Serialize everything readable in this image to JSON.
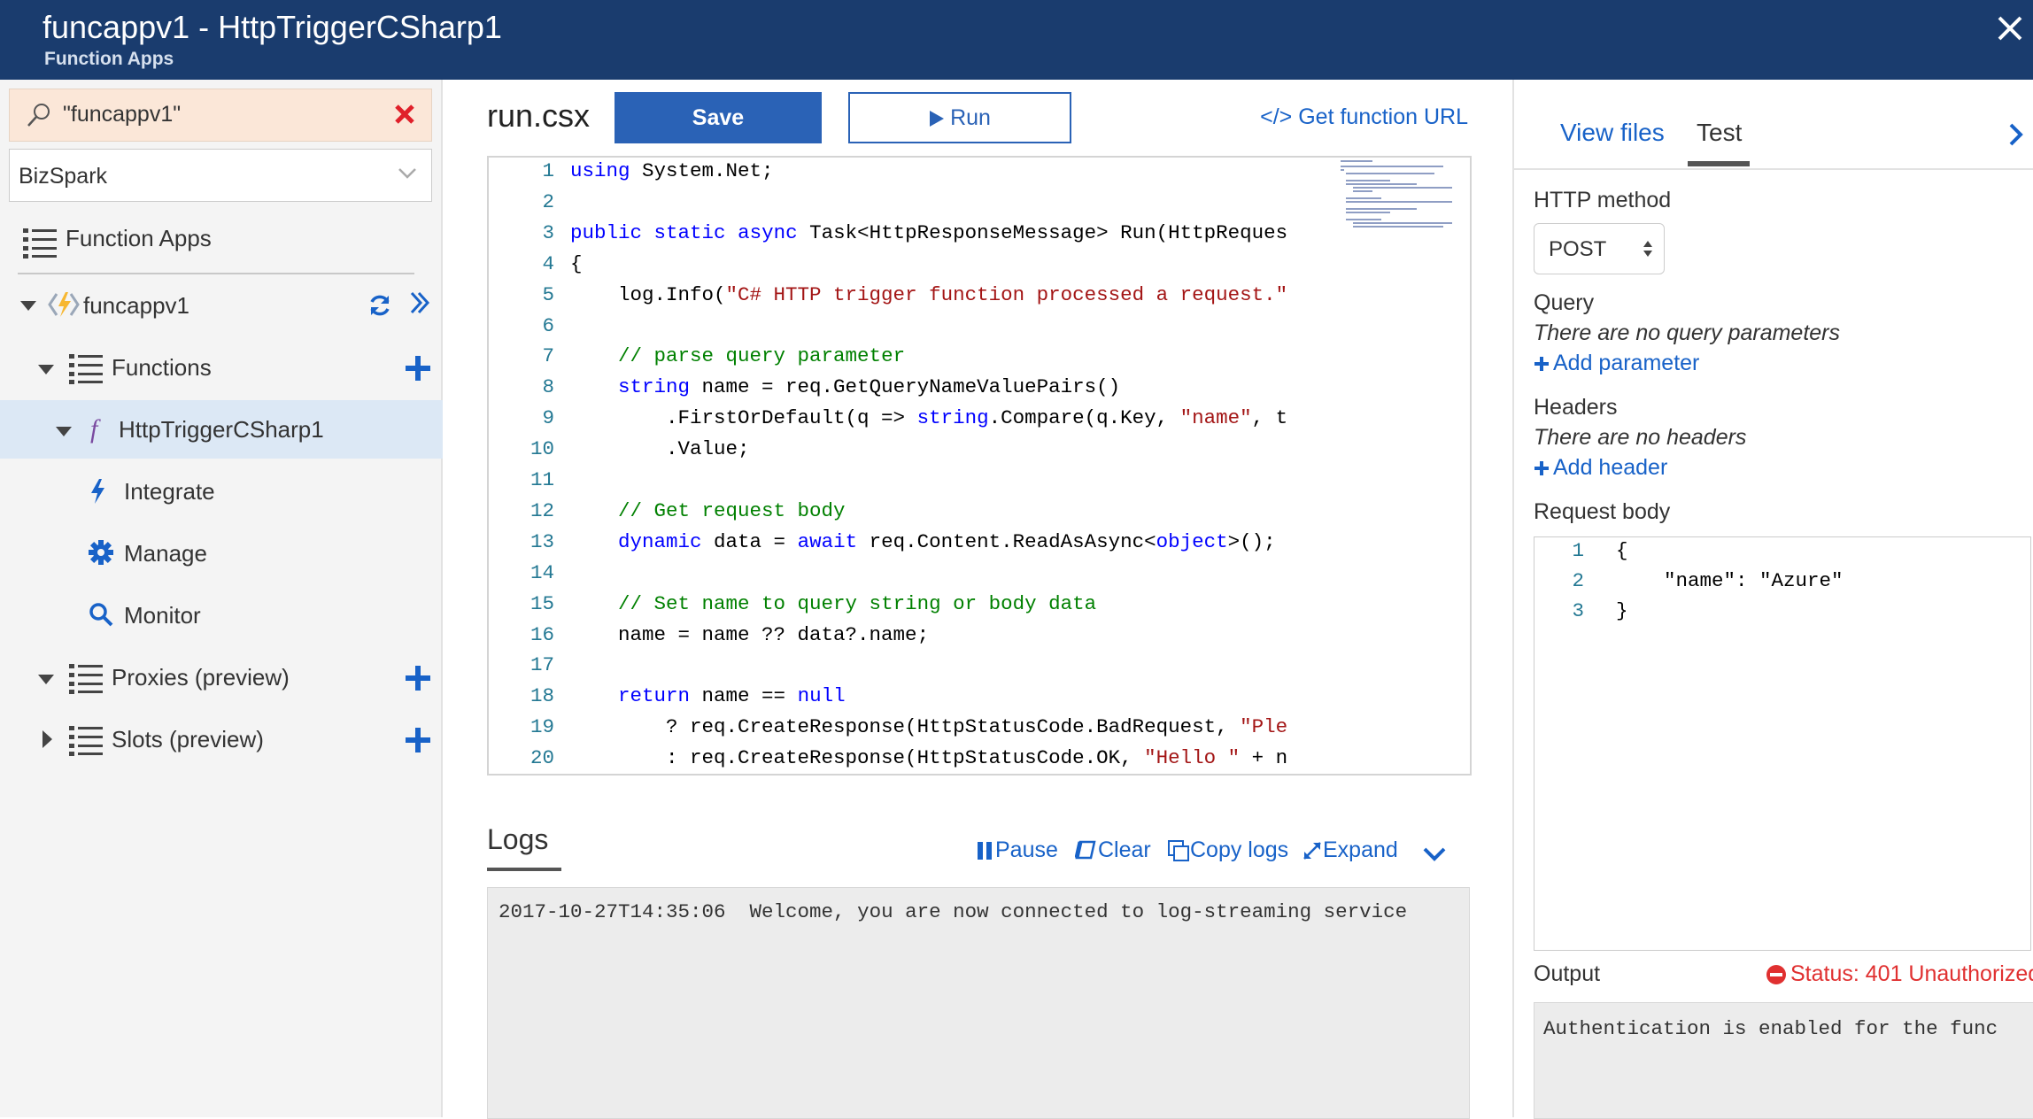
{
  "header": {
    "title": "funcappv1 - HttpTriggerCSharp1",
    "subtitle": "Function Apps"
  },
  "sidebar": {
    "search_value": "\"funcappv1\"",
    "subscription": "BizSpark",
    "function_apps_label": "Function Apps",
    "app_name": "funcappv1",
    "functions_label": "Functions",
    "function_name": "HttpTriggerCSharp1",
    "integrate_label": "Integrate",
    "manage_label": "Manage",
    "monitor_label": "Monitor",
    "proxies_label": "Proxies (preview)",
    "slots_label": "Slots (preview)"
  },
  "editor": {
    "filename": "run.csx",
    "save_label": "Save",
    "run_label": "Run",
    "function_url_label": "Get function URL",
    "lines": [
      "using System.Net;",
      "",
      "public static async Task<HttpResponseMessage> Run(HttpReques",
      "{",
      "    log.Info(\"C# HTTP trigger function processed a request.\"",
      "",
      "    // parse query parameter",
      "    string name = req.GetQueryNameValuePairs()",
      "        .FirstOrDefault(q => string.Compare(q.Key, \"name\", t",
      "        .Value;",
      "",
      "    // Get request body",
      "    dynamic data = await req.Content.ReadAsAsync<object>();",
      "",
      "    // Set name to query string or body data",
      "    name = name ?? data?.name;",
      "",
      "    return name == null",
      "        ? req.CreateResponse(HttpStatusCode.BadRequest, \"Ple",
      "        : req.CreateResponse(HttpStatusCode.OK, \"Hello \" + n"
    ]
  },
  "logs": {
    "tab_label": "Logs",
    "pause_label": "Pause",
    "clear_label": "Clear",
    "copy_label": "Copy logs",
    "expand_label": "Expand",
    "entry": "2017-10-27T14:35:06  Welcome, you are now connected to log-streaming service"
  },
  "test_panel": {
    "view_files_tab": "View files",
    "test_tab": "Test",
    "http_method_label": "HTTP method",
    "http_method_value": "POST",
    "query_label": "Query",
    "query_note": "There are no query parameters",
    "add_parameter": "Add parameter",
    "headers_label": "Headers",
    "headers_note": "There are no headers",
    "add_header": "Add header",
    "request_body_label": "Request body",
    "request_body_lines": [
      "{",
      "    \"name\": \"Azure\"",
      "}"
    ],
    "output_label": "Output",
    "status": "Status: 401 Unauthorized",
    "output_text": "Authentication is enabled for the func"
  },
  "colors": {
    "header": "#1a3c6e",
    "accent": "#2a62b6",
    "link": "#1862c8",
    "error": "#e03030"
  }
}
